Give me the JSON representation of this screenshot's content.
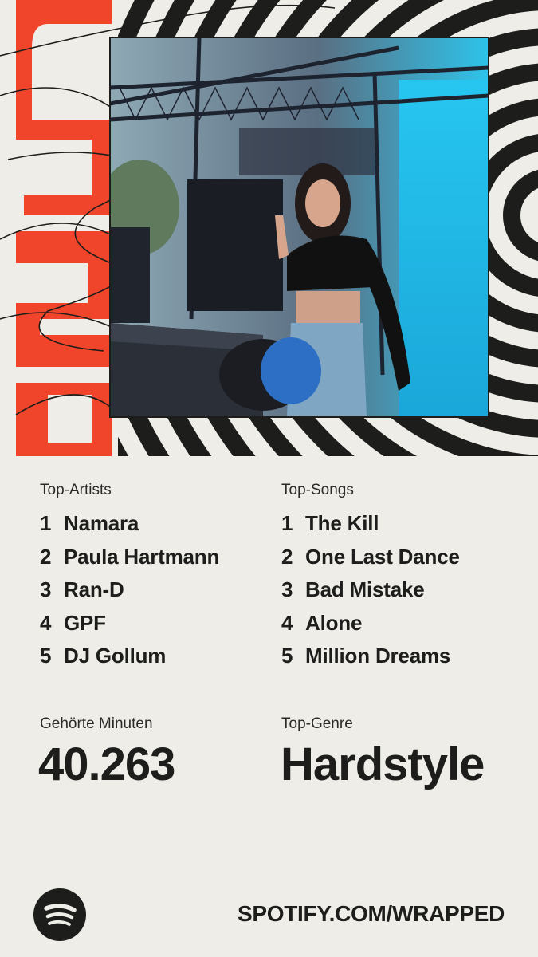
{
  "header": {
    "year_graphic_text": "2025",
    "accent_color": "#f0452b",
    "stripe_color": "#1d1d1b",
    "photo_description_icon": "dj-photo"
  },
  "top_artists": {
    "label": "Top-Artists",
    "items": [
      {
        "rank": "1",
        "name": "Namara"
      },
      {
        "rank": "2",
        "name": "Paula Hartmann"
      },
      {
        "rank": "3",
        "name": "Ran-D"
      },
      {
        "rank": "4",
        "name": "GPF"
      },
      {
        "rank": "5",
        "name": "DJ Gollum"
      }
    ]
  },
  "top_songs": {
    "label": "Top-Songs",
    "items": [
      {
        "rank": "1",
        "name": "The Kill"
      },
      {
        "rank": "2",
        "name": "One Last Dance"
      },
      {
        "rank": "3",
        "name": "Bad Mistake"
      },
      {
        "rank": "4",
        "name": "Alone"
      },
      {
        "rank": "5",
        "name": "Million Dreams"
      }
    ]
  },
  "minutes": {
    "label": "Gehörte Minuten",
    "value": "40.263"
  },
  "genre": {
    "label": "Top-Genre",
    "value": "Hardstyle"
  },
  "footer": {
    "logo_icon": "spotify-logo-icon",
    "url": "SPOTIFY.COM/WRAPPED"
  }
}
